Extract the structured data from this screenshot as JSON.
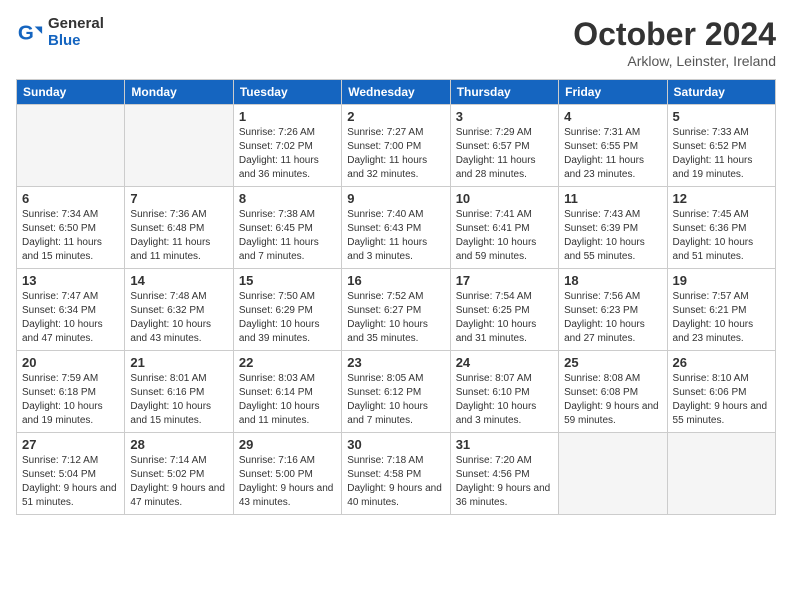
{
  "header": {
    "logo_general": "General",
    "logo_blue": "Blue",
    "month_title": "October 2024",
    "location": "Arklow, Leinster, Ireland"
  },
  "days_of_week": [
    "Sunday",
    "Monday",
    "Tuesday",
    "Wednesday",
    "Thursday",
    "Friday",
    "Saturday"
  ],
  "weeks": [
    [
      {
        "day": "",
        "empty": true
      },
      {
        "day": "",
        "empty": true
      },
      {
        "day": "1",
        "sunrise": "7:26 AM",
        "sunset": "7:02 PM",
        "daylight": "11 hours and 36 minutes."
      },
      {
        "day": "2",
        "sunrise": "7:27 AM",
        "sunset": "7:00 PM",
        "daylight": "11 hours and 32 minutes."
      },
      {
        "day": "3",
        "sunrise": "7:29 AM",
        "sunset": "6:57 PM",
        "daylight": "11 hours and 28 minutes."
      },
      {
        "day": "4",
        "sunrise": "7:31 AM",
        "sunset": "6:55 PM",
        "daylight": "11 hours and 23 minutes."
      },
      {
        "day": "5",
        "sunrise": "7:33 AM",
        "sunset": "6:52 PM",
        "daylight": "11 hours and 19 minutes."
      }
    ],
    [
      {
        "day": "6",
        "sunrise": "7:34 AM",
        "sunset": "6:50 PM",
        "daylight": "11 hours and 15 minutes."
      },
      {
        "day": "7",
        "sunrise": "7:36 AM",
        "sunset": "6:48 PM",
        "daylight": "11 hours and 11 minutes."
      },
      {
        "day": "8",
        "sunrise": "7:38 AM",
        "sunset": "6:45 PM",
        "daylight": "11 hours and 7 minutes."
      },
      {
        "day": "9",
        "sunrise": "7:40 AM",
        "sunset": "6:43 PM",
        "daylight": "11 hours and 3 minutes."
      },
      {
        "day": "10",
        "sunrise": "7:41 AM",
        "sunset": "6:41 PM",
        "daylight": "10 hours and 59 minutes."
      },
      {
        "day": "11",
        "sunrise": "7:43 AM",
        "sunset": "6:39 PM",
        "daylight": "10 hours and 55 minutes."
      },
      {
        "day": "12",
        "sunrise": "7:45 AM",
        "sunset": "6:36 PM",
        "daylight": "10 hours and 51 minutes."
      }
    ],
    [
      {
        "day": "13",
        "sunrise": "7:47 AM",
        "sunset": "6:34 PM",
        "daylight": "10 hours and 47 minutes."
      },
      {
        "day": "14",
        "sunrise": "7:48 AM",
        "sunset": "6:32 PM",
        "daylight": "10 hours and 43 minutes."
      },
      {
        "day": "15",
        "sunrise": "7:50 AM",
        "sunset": "6:29 PM",
        "daylight": "10 hours and 39 minutes."
      },
      {
        "day": "16",
        "sunrise": "7:52 AM",
        "sunset": "6:27 PM",
        "daylight": "10 hours and 35 minutes."
      },
      {
        "day": "17",
        "sunrise": "7:54 AM",
        "sunset": "6:25 PM",
        "daylight": "10 hours and 31 minutes."
      },
      {
        "day": "18",
        "sunrise": "7:56 AM",
        "sunset": "6:23 PM",
        "daylight": "10 hours and 27 minutes."
      },
      {
        "day": "19",
        "sunrise": "7:57 AM",
        "sunset": "6:21 PM",
        "daylight": "10 hours and 23 minutes."
      }
    ],
    [
      {
        "day": "20",
        "sunrise": "7:59 AM",
        "sunset": "6:18 PM",
        "daylight": "10 hours and 19 minutes."
      },
      {
        "day": "21",
        "sunrise": "8:01 AM",
        "sunset": "6:16 PM",
        "daylight": "10 hours and 15 minutes."
      },
      {
        "day": "22",
        "sunrise": "8:03 AM",
        "sunset": "6:14 PM",
        "daylight": "10 hours and 11 minutes."
      },
      {
        "day": "23",
        "sunrise": "8:05 AM",
        "sunset": "6:12 PM",
        "daylight": "10 hours and 7 minutes."
      },
      {
        "day": "24",
        "sunrise": "8:07 AM",
        "sunset": "6:10 PM",
        "daylight": "10 hours and 3 minutes."
      },
      {
        "day": "25",
        "sunrise": "8:08 AM",
        "sunset": "6:08 PM",
        "daylight": "9 hours and 59 minutes."
      },
      {
        "day": "26",
        "sunrise": "8:10 AM",
        "sunset": "6:06 PM",
        "daylight": "9 hours and 55 minutes."
      }
    ],
    [
      {
        "day": "27",
        "sunrise": "7:12 AM",
        "sunset": "5:04 PM",
        "daylight": "9 hours and 51 minutes."
      },
      {
        "day": "28",
        "sunrise": "7:14 AM",
        "sunset": "5:02 PM",
        "daylight": "9 hours and 47 minutes."
      },
      {
        "day": "29",
        "sunrise": "7:16 AM",
        "sunset": "5:00 PM",
        "daylight": "9 hours and 43 minutes."
      },
      {
        "day": "30",
        "sunrise": "7:18 AM",
        "sunset": "4:58 PM",
        "daylight": "9 hours and 40 minutes."
      },
      {
        "day": "31",
        "sunrise": "7:20 AM",
        "sunset": "4:56 PM",
        "daylight": "9 hours and 36 minutes."
      },
      {
        "day": "",
        "empty": true
      },
      {
        "day": "",
        "empty": true
      }
    ]
  ]
}
